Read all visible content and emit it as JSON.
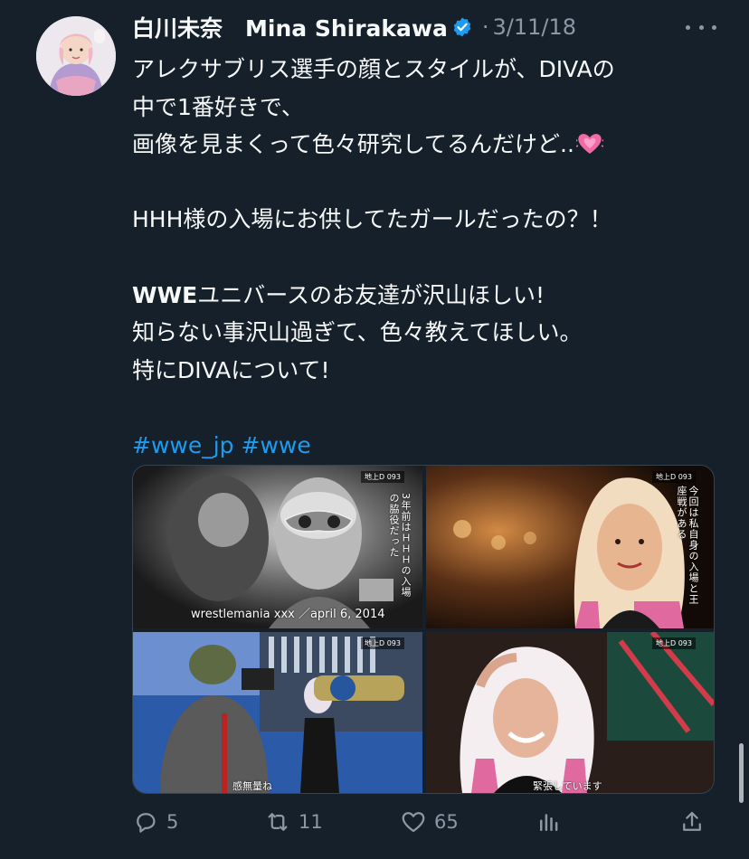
{
  "author": {
    "display_name": "白川未奈　Mina Shirakawa",
    "verified": true,
    "separator": "·",
    "date": "3/11/18"
  },
  "tweet": {
    "lines": [
      "アレクサブリス選手の顔とスタイルが、DIVAの",
      "中で1番好きで、",
      "画像を見まくって色々研究してるんだけど..",
      "",
      "HHH様の入場にお供してたガールだったの？！",
      "",
      "ユニバースのお友達が沢山ほしい!",
      "知らない事沢山過ぎて、色々教えてほしい。",
      "特にDIVAについて!",
      ""
    ],
    "bold_prefix": "WWE",
    "hashtags": [
      "#wwe_jp",
      "#wwe"
    ],
    "emoji": "heart-emoji"
  },
  "media": {
    "images": [
      {
        "caption_vertical": "3年前はＨＨＨの入場の脇役だった",
        "watermark": "wrestlemania xxx ／april 6, 2014",
        "channel": "地上D 093"
      },
      {
        "caption_vertical": "今回は私自身の入場と王座戦がある",
        "channel": "地上D 093"
      },
      {
        "caption_bottom": "感無量ね",
        "channel": "地上D 093"
      },
      {
        "caption_bottom": "緊張しています",
        "channel": "地上D 093"
      }
    ]
  },
  "actions": {
    "reply_count": "5",
    "retweet_count": "11",
    "like_count": "65",
    "icons": [
      "reply-icon",
      "retweet-icon",
      "like-icon",
      "views-icon",
      "share-icon"
    ]
  },
  "colors": {
    "background": "#15202b",
    "text": "#f7f9f9",
    "muted": "#8b98a5",
    "accent": "#1d9bf0"
  }
}
